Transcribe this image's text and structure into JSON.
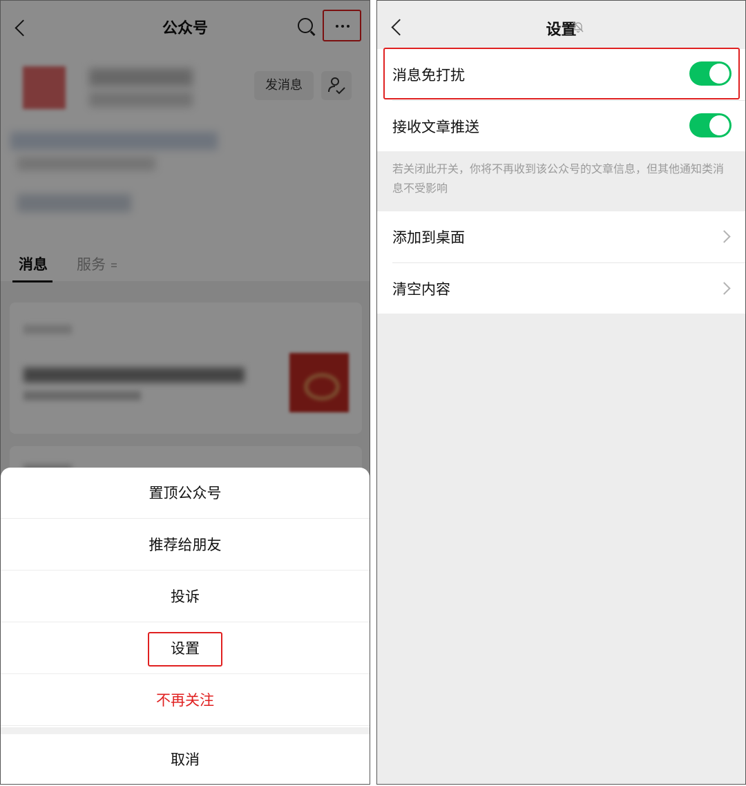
{
  "left": {
    "nav": {
      "title": "公众号",
      "back_icon": "chevron-left-icon",
      "search_icon": "search-icon",
      "more_icon": "more-icon"
    },
    "profile": {
      "send_message_label": "发消息",
      "follow_icon": "user-check-icon"
    },
    "tabs": [
      {
        "label": "消息"
      },
      {
        "label": "服务"
      }
    ],
    "action_sheet": {
      "items": [
        {
          "label": "置顶公众号"
        },
        {
          "label": "推荐给朋友"
        },
        {
          "label": "投诉"
        },
        {
          "label": "设置"
        },
        {
          "label": "不再关注"
        }
      ],
      "cancel_label": "取消"
    }
  },
  "right": {
    "nav": {
      "title": "设置",
      "back_icon": "chevron-left-icon",
      "mute_icon": "bell-off-icon"
    },
    "toggles": [
      {
        "label": "消息免打扰",
        "on": true
      },
      {
        "label": "接收文章推送",
        "on": true
      }
    ],
    "hint": "若关闭此开关，你将不再收到该公众号的文章信息，但其他通知类消息不受影响",
    "nav_items": [
      {
        "label": "添加到桌面"
      },
      {
        "label": "清空内容"
      }
    ]
  },
  "colors": {
    "accent_green": "#07c160",
    "danger_red": "#e02020",
    "highlight_border": "#e02020"
  }
}
